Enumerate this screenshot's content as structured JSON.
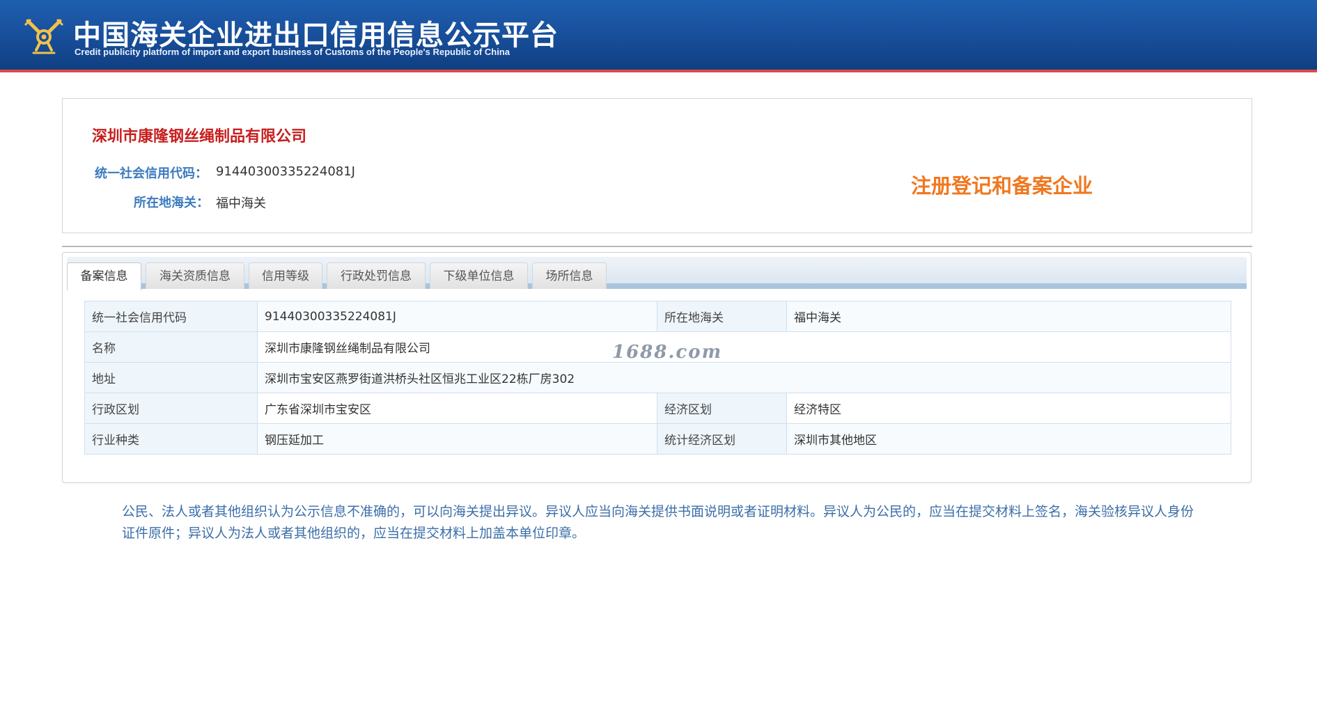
{
  "header": {
    "title_cn": "中国海关企业进出口信用信息公示平台",
    "title_en": "Credit publicity platform of import and export business of Customs of the People's Republic of China",
    "emblem_icon": "customs-emblem-icon"
  },
  "company": {
    "name": "深圳市康隆钢丝绳制品有限公司",
    "credit_code_label": "统一社会信用代码：",
    "credit_code": "91440300335224081J",
    "customs_label": "所在地海关：",
    "customs": "福中海关",
    "registration_status": "注册登记和备案企业"
  },
  "tabs": [
    {
      "label": "备案信息",
      "active": true
    },
    {
      "label": "海关资质信息",
      "active": false
    },
    {
      "label": "信用等级",
      "active": false
    },
    {
      "label": "行政处罚信息",
      "active": false
    },
    {
      "label": "下级单位信息",
      "active": false
    },
    {
      "label": "场所信息",
      "active": false
    }
  ],
  "table": {
    "rows": [
      {
        "l1": "统一社会信用代码",
        "v1": "91440300335224081J",
        "l2": "所在地海关",
        "v2": "福中海关"
      },
      {
        "l1": "名称",
        "v1": "深圳市康隆钢丝绳制品有限公司"
      },
      {
        "l1": "地址",
        "v1": "深圳市宝安区燕罗街道洪桥头社区恒兆工业区22栋厂房302"
      },
      {
        "l1": "行政区划",
        "v1": "广东省深圳市宝安区",
        "l2": "经济区划",
        "v2": "经济特区"
      },
      {
        "l1": "行业种类",
        "v1": "钢压延加工",
        "l2": "统计经济区划",
        "v2": "深圳市其他地区"
      }
    ]
  },
  "watermark": "1688.com",
  "notice": "公民、法人或者其他组织认为公示信息不准确的，可以向海关提出异议。异议人应当向海关提供书面说明或者证明材料。异议人为公民的，应当在提交材料上签名，海关验核异议人身份证件原件；异议人为法人或者其他组织的，应当在提交材料上加盖本单位印章。",
  "colors": {
    "header_blue": "#174d98",
    "header_red_line": "#d94b4b",
    "company_red": "#c81e1e",
    "label_blue": "#3b7bbf",
    "status_orange": "#f07820",
    "notice_blue": "#3b6ea8"
  }
}
